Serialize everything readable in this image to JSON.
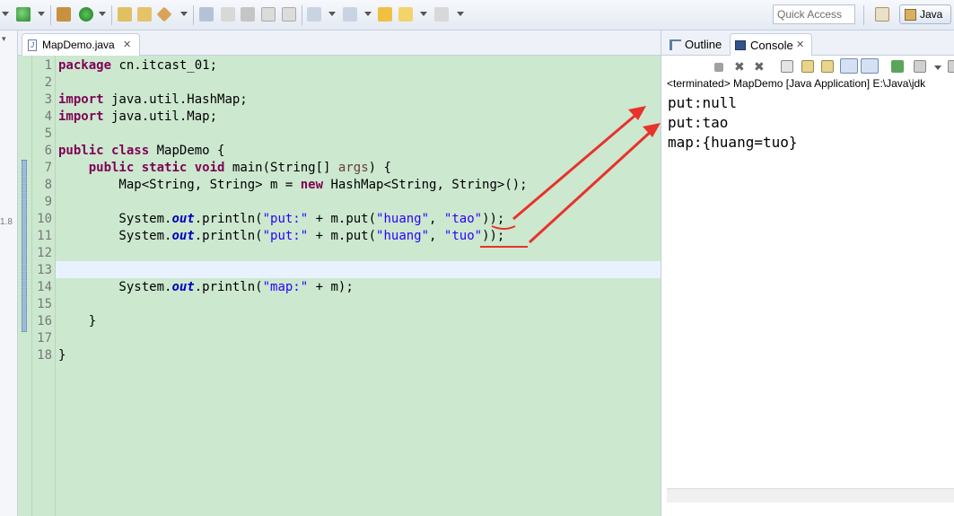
{
  "toolbar": {
    "quick_access_placeholder": "Quick Access",
    "perspective_label": "Java"
  },
  "editor": {
    "tab_label": "MapDemo.java",
    "file_icon_glyph": "J",
    "line_numbers": [
      "1",
      "2",
      "3",
      "4",
      "5",
      "6",
      "7",
      "8",
      "9",
      "10",
      "11",
      "12",
      "13",
      "14",
      "15",
      "16",
      "17",
      "18"
    ],
    "left_strip_mark": "1.8"
  },
  "views": {
    "outline_tab": "Outline",
    "console_tab": "Console"
  },
  "console": {
    "header": "<terminated> MapDemo [Java Application] E:\\Java\\jdk",
    "lines": [
      "put:null",
      "put:tao",
      "map:{huang=tuo}"
    ]
  },
  "colors": {
    "editor_bg": "#cce8cf",
    "current_line": "#e8f2fe",
    "keyword": "#7f0055",
    "string": "#2a00ff",
    "annotation_red": "#e8322b"
  }
}
